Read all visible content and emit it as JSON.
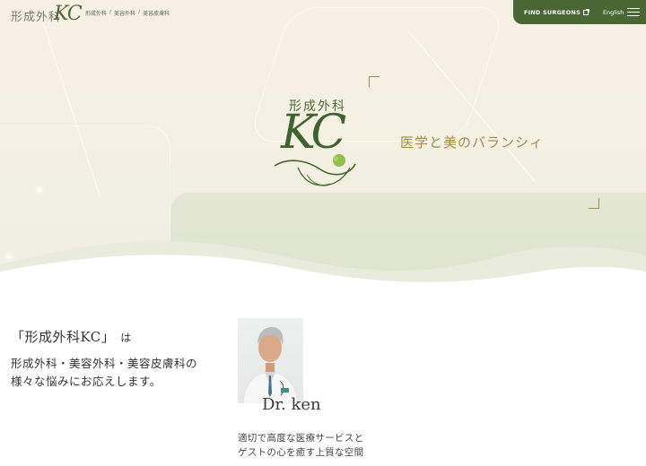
{
  "header": {
    "logo_text": "形成外科",
    "logo_mark": "KC",
    "breadcrumb": [
      "形成外科",
      "/",
      "美容外科",
      "/",
      "美容皮膚科"
    ],
    "find_surgeons_label": "FIND SURGEONS",
    "language_label": "English",
    "menu_icon": "hamburger-menu-icon",
    "accent_color": "#4a6633"
  },
  "hero": {
    "emblem_title": "形成外科",
    "emblem_mark": "KC",
    "tagline": "医学と美のバランシィ",
    "tagline_color": "#a68a4c"
  },
  "intro": {
    "line1": "「形成外科KC」",
    "line1_suffix": "は",
    "line2": "形成外科・美容外科・美容皮膚科の",
    "line3": "様々な悩みにお応えします。"
  },
  "doctor": {
    "name": "Dr. ken",
    "desc_line1": "適切で高度な医療サービスと",
    "desc_line2": "ゲストの心を癒す上質な空間"
  }
}
